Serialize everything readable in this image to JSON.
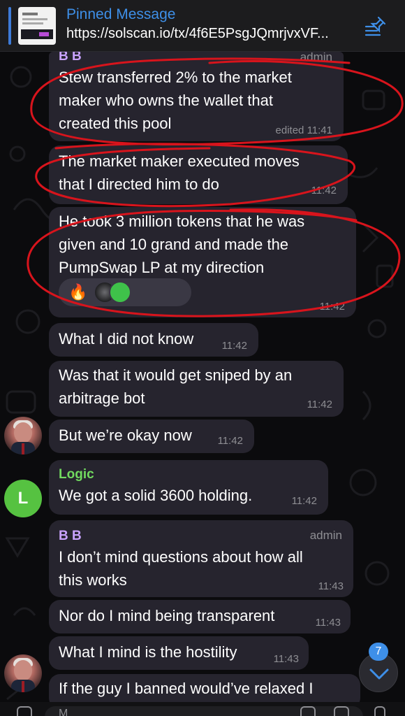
{
  "pinned": {
    "title": "Pinned Message",
    "url": "https://solscan.io/tx/4f6E5PsgJQmrjvxVF..."
  },
  "messages": [
    {
      "sender": "B B",
      "role": "admin",
      "lines": [
        "Stew transferred 2% to the market",
        "maker who owns the wallet that",
        "created this pool"
      ],
      "time": "edited 11:41"
    },
    {
      "lines": [
        "The market maker executed moves",
        "that I directed him to do"
      ],
      "time": "11:42"
    },
    {
      "lines": [
        "He took 3 million tokens that he was",
        "given and 10 grand and made the",
        "PumpSwap LP at my direction"
      ],
      "time": "11:42",
      "reaction": "🔥"
    },
    {
      "lines": [
        "What I did not know"
      ],
      "time": "11:42"
    },
    {
      "lines": [
        "Was that it would get sniped by an",
        "arbitrage bot"
      ],
      "time": "11:42"
    },
    {
      "lines": [
        "But we’re okay now"
      ],
      "time": "11:42"
    },
    {
      "sender": "Logic",
      "lines": [
        "We got a solid 3600 holding."
      ],
      "time": "11:42",
      "avatar_letter": "L"
    },
    {
      "sender": "B B",
      "role": "admin",
      "lines": [
        "I don’t mind questions about how all",
        "this works"
      ],
      "time": "11:43"
    },
    {
      "lines": [
        "Nor do I mind being transparent"
      ],
      "time": "11:43"
    },
    {
      "lines": [
        "What I mind is the hostility"
      ],
      "time": "11:43"
    },
    {
      "lines": [
        "If the guy I banned would’ve relaxed I"
      ]
    }
  ],
  "unread_count": "7",
  "composer": {
    "placeholder": "M"
  },
  "colors": {
    "background": "#0b0b0d",
    "bubble": "#26242e",
    "accent_blue": "#3e8fe8",
    "sender_bb": "#c9a3ff",
    "sender_logic": "#71d95f",
    "annotation_red": "#d8141c"
  },
  "icons": [
    "pin-list-icon",
    "chevron-down-icon",
    "fire-icon",
    "attach-icon",
    "sticker-icon",
    "mic-icon"
  ]
}
